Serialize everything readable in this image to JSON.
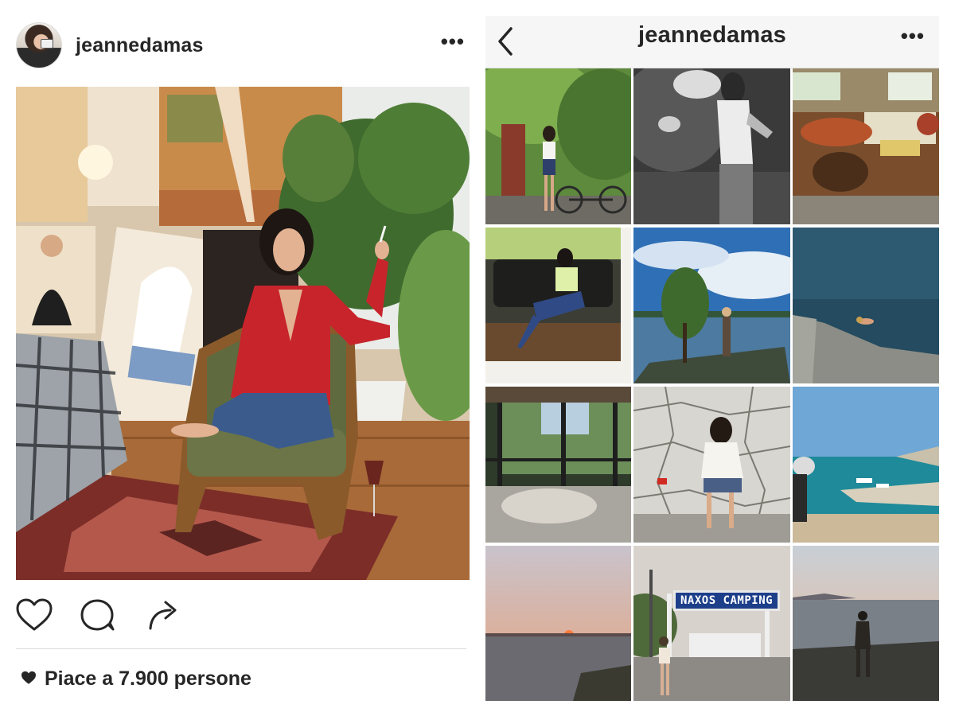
{
  "post": {
    "username": "jeannedamas",
    "more_label": "•••",
    "likes_text": "Piace a 7.900 persone",
    "icons": [
      "heart-icon",
      "comment-icon",
      "share-icon"
    ]
  },
  "profile": {
    "title": "jeannedamas",
    "more_label": "•••",
    "back_icon": "chevron-left-icon",
    "tiles": [
      {
        "name": "tile-ivy-wall-bicycle"
      },
      {
        "name": "tile-garden-bw"
      },
      {
        "name": "tile-living-room"
      },
      {
        "name": "tile-polaroid-sofa"
      },
      {
        "name": "tile-lake-tree"
      },
      {
        "name": "tile-swimming-sea"
      },
      {
        "name": "tile-veranda-view"
      },
      {
        "name": "tile-stone-terrace"
      },
      {
        "name": "tile-harbor-boats"
      },
      {
        "name": "tile-sunset-sea"
      },
      {
        "name": "tile-naxos-camping",
        "sign_text": "NAXOS CAMPING"
      },
      {
        "name": "tile-dusk-silhouette"
      }
    ]
  },
  "colors": {
    "text": "#262626",
    "divider": "#dbdbdb",
    "topbar_bg": "#f6f6f6",
    "sign_blue": "#1d3f8a"
  }
}
